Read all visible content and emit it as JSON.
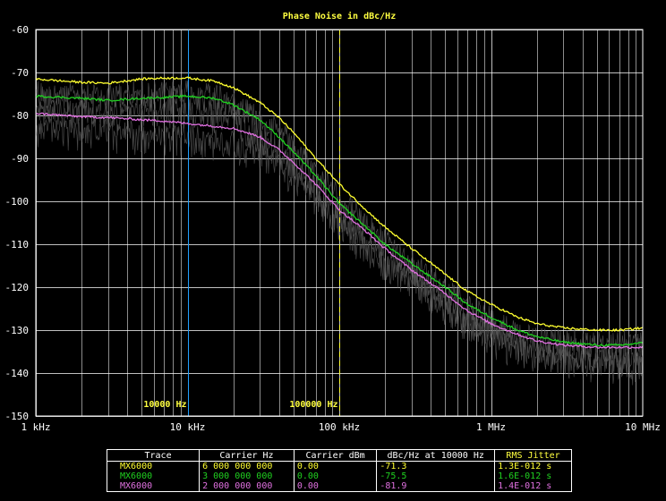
{
  "chart_data": {
    "type": "line",
    "title": "Phase Noise in dBc/Hz",
    "xscale": "log",
    "xlim": [
      1000,
      10000000
    ],
    "ylim": [
      -150,
      -60
    ],
    "grid": true,
    "x_tick_values": [
      1000,
      10000,
      100000,
      1000000,
      10000000
    ],
    "x_tick_labels": [
      "1 kHz",
      "10 kHz",
      "100 kHz",
      "1 MHz",
      "10 MHz"
    ],
    "y_tick_values": [
      -60,
      -70,
      -80,
      -90,
      -100,
      -110,
      -120,
      -130,
      -140,
      -150
    ],
    "y_tick_labels": [
      "-60",
      "-70",
      "-80",
      "-90",
      "-100",
      "-110",
      "-120",
      "-130",
      "-140",
      "-150"
    ],
    "markers": [
      {
        "label": "10000 Hz",
        "x": 10000,
        "color": "#20a0ff"
      },
      {
        "label": "100000 Hz",
        "x": 100000,
        "color": "#ffff30"
      }
    ],
    "series": [
      {
        "color": "#ffff30",
        "x": [
          1000,
          1500,
          2000,
          3000,
          5000,
          7000,
          10000,
          15000,
          20000,
          30000,
          40000,
          50000,
          70000,
          100000,
          150000,
          200000,
          300000,
          500000,
          700000,
          1000000,
          1500000,
          2000000,
          3000000,
          5000000,
          7000000,
          10000000
        ],
        "y": [
          -71.5,
          -72,
          -72.3,
          -72.5,
          -71.5,
          -71.3,
          -71.3,
          -72,
          -73.5,
          -77,
          -80.5,
          -84,
          -90,
          -96,
          -102,
          -106,
          -111,
          -117,
          -121,
          -124,
          -127,
          -128.5,
          -129.5,
          -130,
          -130,
          -129.5
        ]
      },
      {
        "color": "#20d020",
        "x": [
          1000,
          1500,
          2000,
          3000,
          5000,
          7000,
          10000,
          15000,
          20000,
          30000,
          40000,
          50000,
          70000,
          100000,
          150000,
          200000,
          300000,
          500000,
          700000,
          1000000,
          1500000,
          2000000,
          3000000,
          5000000,
          7000000,
          10000000
        ],
        "y": [
          -75.5,
          -75.8,
          -76,
          -76.5,
          -76,
          -75.8,
          -75.5,
          -76,
          -77.5,
          -81,
          -85,
          -88.5,
          -94,
          -100.5,
          -106,
          -110,
          -114.5,
          -120,
          -124,
          -127,
          -130,
          -131.5,
          -132.8,
          -133.5,
          -133.5,
          -133
        ]
      },
      {
        "color": "#e070e0",
        "x": [
          1000,
          1500,
          2000,
          3000,
          5000,
          7000,
          10000,
          15000,
          20000,
          30000,
          40000,
          50000,
          70000,
          100000,
          150000,
          200000,
          300000,
          500000,
          700000,
          1000000,
          1500000,
          2000000,
          3000000,
          5000000,
          7000000,
          10000000
        ],
        "y": [
          -79.5,
          -80,
          -80.3,
          -80.5,
          -81,
          -81.3,
          -81.9,
          -82.5,
          -83,
          -85,
          -88,
          -91,
          -96,
          -102,
          -107,
          -111,
          -116,
          -121.5,
          -125.5,
          -128.5,
          -131,
          -132.5,
          -133.5,
          -134,
          -134,
          -134
        ]
      }
    ],
    "legend_table": {
      "headers": [
        "Trace",
        "Carrier Hz",
        "Carrier dBm",
        "dBc/Hz at 10000 Hz",
        "RMS Jitter"
      ],
      "rows": [
        {
          "color": "#ffff30",
          "cells": [
            "MX6000",
            "6 000 000 000",
            "0.00",
            "-71.3",
            "1.3E-012 s"
          ]
        },
        {
          "color": "#20d020",
          "cells": [
            "MX6000",
            "3 000 000 000",
            "0.00",
            "-75.5",
            "1.6E-012 s"
          ]
        },
        {
          "color": "#e070e0",
          "cells": [
            "MX6000",
            "2 000 000 000",
            "0.00",
            "-81.9",
            "1.4E-012 s"
          ]
        }
      ]
    }
  },
  "colors": {
    "background": "#000000",
    "grid": "#ffffff",
    "title": "#ffff40",
    "noise": "#5a5a5a"
  }
}
